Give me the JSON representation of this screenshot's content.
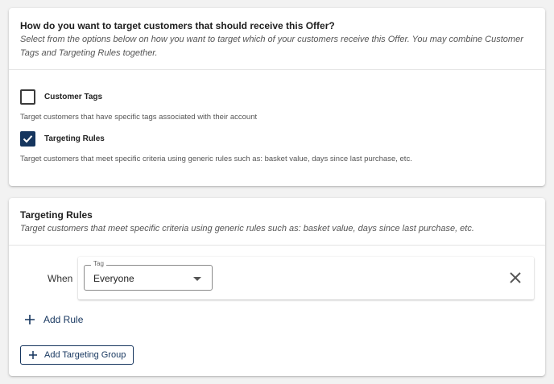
{
  "target_card": {
    "title": "How do you want to target customers that should receive this Offer?",
    "subtitle": "Select from the options below on how you want to target which of your customers receive this Offer. You may combine Customer Tags and Targeting Rules together.",
    "options": [
      {
        "label": "Customer Tags",
        "description": "Target customers that have specific tags associated with their account",
        "checked": false
      },
      {
        "label": "Targeting Rules",
        "description": "Target customers that meet specific criteria using generic rules such as: basket value, days since last purchase, etc.",
        "checked": true
      }
    ]
  },
  "rules_card": {
    "title": "Targeting Rules",
    "subtitle": "Target customers that meet specific criteria using generic rules such as: basket value, days since last purchase, etc.",
    "rule": {
      "when_label": "When",
      "field_label": "Tag",
      "field_value": "Everyone"
    },
    "add_rule_label": "Add Rule",
    "add_group_label": "Add Targeting Group"
  },
  "colors": {
    "accent": "#15355e",
    "page_bg": "#f2f2f2"
  },
  "icons": {
    "checked": "checkmark-icon",
    "remove": "close-icon",
    "add": "plus-icon",
    "dropdown": "caret-down-icon"
  }
}
